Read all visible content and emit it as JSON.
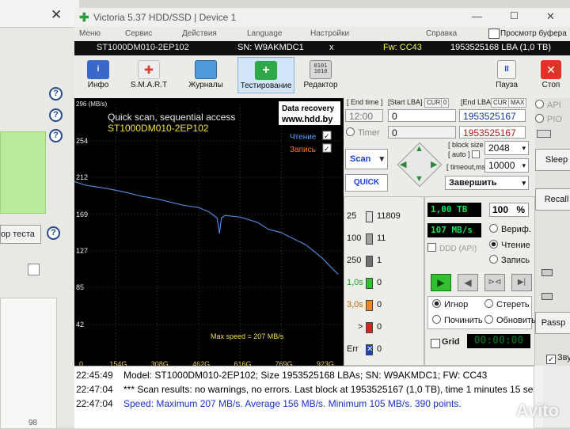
{
  "bg_window": {
    "button_label": "ор теста",
    "scroll_value": "98"
  },
  "title": "Victoria 5.37 HDD/SSD | Device 1",
  "menu": [
    "Меню",
    "Сервис",
    "Действия",
    "Language",
    "Настройки",
    "Справка"
  ],
  "menu_right": "Просмотр буфера",
  "info": {
    "model": "ST1000DM010-2EP102",
    "sn": "SN: W9AKMDC1",
    "close": "x",
    "fw": "Fw: CC43",
    "lba": "1953525168 LBA (1,0 TB)"
  },
  "toolbar": [
    {
      "label": "Инфо",
      "icon": "info-icon",
      "color": "#3a68c8"
    },
    {
      "label": "S.M.A.R.T",
      "icon": "smart-icon",
      "color": "#d24030"
    },
    {
      "label": "Журналы",
      "icon": "journals-icon",
      "color": "#4f9ad8"
    },
    {
      "label": "Тестирование",
      "icon": "test-icon",
      "color": "#2fa84a"
    },
    {
      "label": "Редактор",
      "icon": "editor-icon",
      "color": "#888888"
    }
  ],
  "pause": {
    "label": "Пауза",
    "symbol": "II"
  },
  "stop": {
    "label": "Стоп",
    "symbol": "✕"
  },
  "graph": {
    "unit": "296 (MB/s)",
    "y_ticks": [
      "254",
      "212",
      "169",
      "127",
      "85",
      "42"
    ],
    "x_ticks": [
      "0",
      "154G",
      "308G",
      "462G",
      "616G",
      "769G",
      "923G"
    ],
    "title": "Quick scan, sequential access",
    "model": "ST1000DM010-2EP102",
    "ad_line1": "Data recovery",
    "ad_line2": "www.hdd.by",
    "legend_read": "Чтение",
    "legend_write": "Запись",
    "max_text": "Max speed = 207 MB/s"
  },
  "chart_data": {
    "type": "line",
    "ylabel": "MB/s",
    "ylim": [
      0,
      296
    ],
    "x_ticks": [
      "0",
      "154G",
      "308G",
      "462G",
      "616G",
      "769G",
      "923G"
    ],
    "series": [
      {
        "name": "Чтение",
        "x": [
          0,
          40,
          80,
          120,
          154,
          200,
          250,
          308,
          360,
          400,
          440,
          462,
          500,
          530,
          539,
          546,
          560,
          616,
          680,
          700,
          720,
          769,
          820,
          860,
          900,
          923,
          960,
          980
        ],
        "y": [
          207,
          203,
          201,
          199,
          197,
          194,
          190,
          187,
          183,
          180,
          178,
          177,
          172,
          165,
          147,
          165,
          168,
          166,
          160,
          156,
          152,
          148,
          140,
          134,
          124,
          118,
          106,
          100
        ]
      }
    ]
  },
  "params": {
    "end_time_label": "[ End time ]",
    "start_lba_label": "[Start LBA]",
    "cur": "CUR",
    "zero": "0",
    "end_lba_label": "[End LBA]",
    "max": "MAX",
    "time_value": "12:00",
    "timer_label": "Timer",
    "start_lba": "0",
    "start_lba2": "0",
    "end_lba": "1953525167",
    "end_lba2": "1953525167",
    "block_size_label": "[ block size ]",
    "auto": "[ auto ]",
    "block_size": "2048",
    "timeout_label": "[ timeout,ms ]",
    "timeout": "10000",
    "scan": "Scan",
    "quick": "QUICK",
    "finish": "Завершить"
  },
  "blocks": [
    {
      "label": "25",
      "count": "11809",
      "color": "#e0e0e0"
    },
    {
      "label": "100",
      "count": "11",
      "color": "#a0a0a0"
    },
    {
      "label": "250",
      "count": "1",
      "color": "#707070"
    },
    {
      "label": "1,0s",
      "count": "0",
      "color": "#2ec42e"
    },
    {
      "label": "3,0s",
      "count": "0",
      "color": "#f08a10"
    },
    {
      "label": ">",
      "count": "0",
      "color": "#e02020"
    },
    {
      "label": "Err",
      "count": "0",
      "color": "#1a3ccf"
    }
  ],
  "status": {
    "size": "1,00 TB",
    "percent": "100",
    "pct_sign": "%",
    "speed": "107 MB/s",
    "verify": "Вериф.",
    "read": "Чтение",
    "write": "Запись",
    "ddd": "DDD (API)",
    "ignore": "Игнор",
    "erase": "Стереть",
    "fix": "Починить",
    "refresh": "Обновить",
    "grid": "Grid",
    "clock": "00:00:00"
  },
  "side": {
    "api": "API",
    "pio": "PIO",
    "sleep": "Sleep",
    "recall": "Recall",
    "passp": "Passp",
    "sound": "Зву"
  },
  "log": [
    {
      "time": "22:45:49",
      "text": "Model: ST1000DM010-2EP102; Size 1953525168 LBAs; SN: W9AKMDC1; FW: CC43",
      "color": "#111111"
    },
    {
      "time": "22:47:04",
      "text": "*** Scan results: no warnings, no errors. Last block at 1953525167 (1,0 TB), time 1 minutes 15 se...",
      "color": "#111111"
    },
    {
      "time": "22:47:04",
      "text": "Speed: Maximum 207 MB/s. Average 156 MB/s. Minimum 105 MB/s. 390 points.",
      "color": "#1a2fd0"
    }
  ],
  "watermark": "Avito"
}
